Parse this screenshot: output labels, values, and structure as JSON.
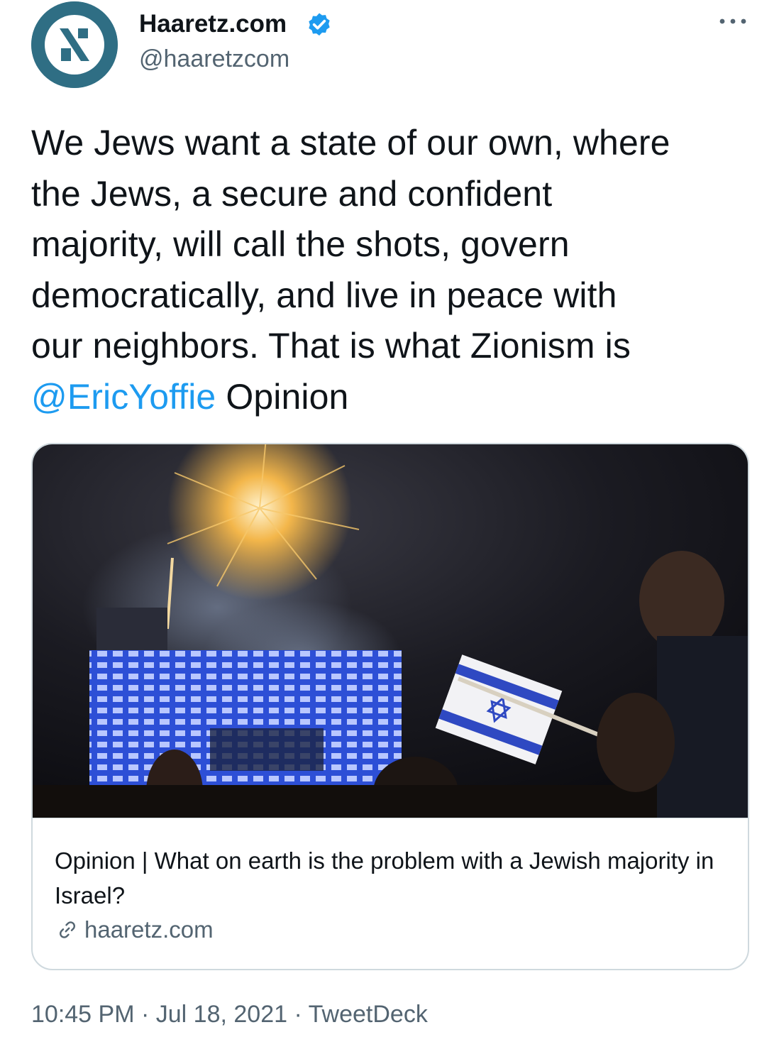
{
  "author": {
    "display_name": "Haaretz.com",
    "handle": "@haaretzcom",
    "verified": true,
    "avatar_icon": "haaretz-logo-icon",
    "avatar_color": "#2f6e84"
  },
  "tweet": {
    "text_lines": [
      "We Jews want a state of our own, where",
      "the Jews, a secure and confident",
      "majority, will call the shots, govern",
      "democratically, and live in peace with",
      "our neighbors. That is what Zionism is"
    ],
    "mention": "@EricYoffie",
    "trailing": "Opinion"
  },
  "card": {
    "title": "Opinion | What on earth is the problem with a Jewish majority in Israel?",
    "domain": "haaretz.com",
    "image_description_icon": "fireworks-flag-photo"
  },
  "meta": {
    "time": "10:45 PM",
    "separator": "·",
    "date": "Jul 18, 2021",
    "source": "TweetDeck"
  },
  "colors": {
    "link": "#1d9bf0",
    "secondary_text": "#536471",
    "border": "#cfd9de",
    "verified": "#1d9bf0"
  }
}
